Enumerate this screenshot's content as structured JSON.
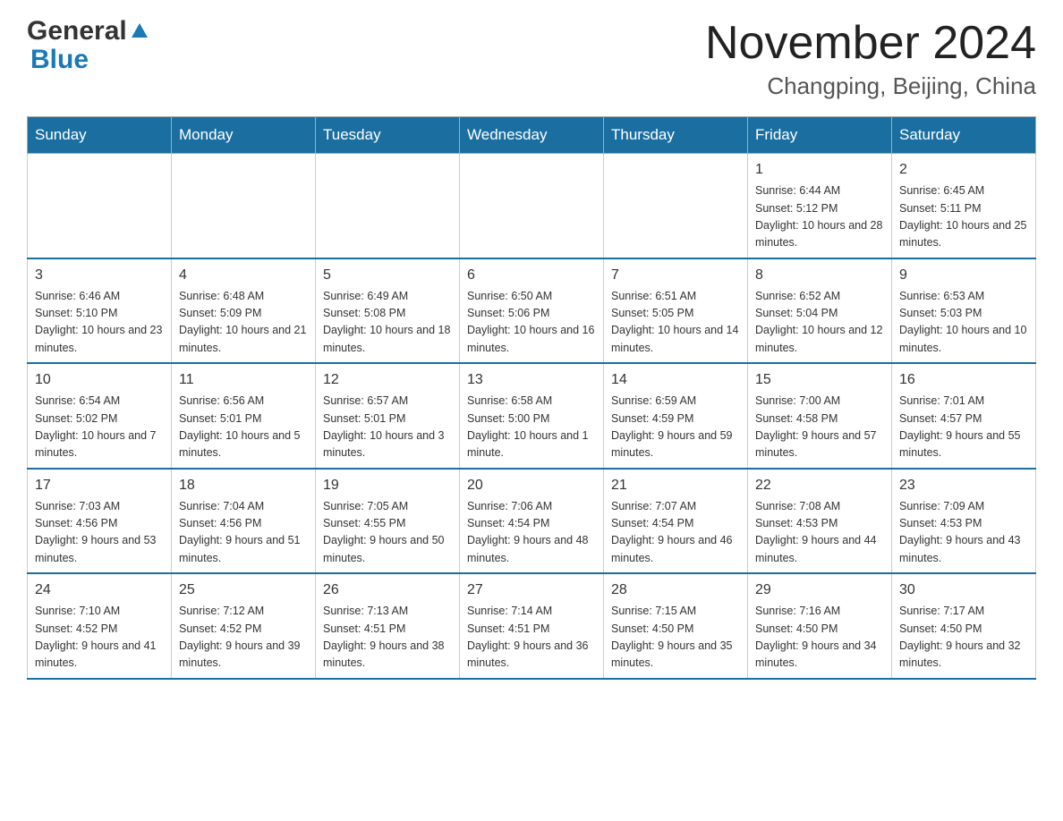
{
  "logo": {
    "general": "General",
    "blue": "Blue"
  },
  "title": "November 2024",
  "subtitle": "Changping, Beijing, China",
  "days_of_week": [
    "Sunday",
    "Monday",
    "Tuesday",
    "Wednesday",
    "Thursday",
    "Friday",
    "Saturday"
  ],
  "weeks": [
    [
      {
        "day": "",
        "info": ""
      },
      {
        "day": "",
        "info": ""
      },
      {
        "day": "",
        "info": ""
      },
      {
        "day": "",
        "info": ""
      },
      {
        "day": "",
        "info": ""
      },
      {
        "day": "1",
        "info": "Sunrise: 6:44 AM\nSunset: 5:12 PM\nDaylight: 10 hours and 28 minutes."
      },
      {
        "day": "2",
        "info": "Sunrise: 6:45 AM\nSunset: 5:11 PM\nDaylight: 10 hours and 25 minutes."
      }
    ],
    [
      {
        "day": "3",
        "info": "Sunrise: 6:46 AM\nSunset: 5:10 PM\nDaylight: 10 hours and 23 minutes."
      },
      {
        "day": "4",
        "info": "Sunrise: 6:48 AM\nSunset: 5:09 PM\nDaylight: 10 hours and 21 minutes."
      },
      {
        "day": "5",
        "info": "Sunrise: 6:49 AM\nSunset: 5:08 PM\nDaylight: 10 hours and 18 minutes."
      },
      {
        "day": "6",
        "info": "Sunrise: 6:50 AM\nSunset: 5:06 PM\nDaylight: 10 hours and 16 minutes."
      },
      {
        "day": "7",
        "info": "Sunrise: 6:51 AM\nSunset: 5:05 PM\nDaylight: 10 hours and 14 minutes."
      },
      {
        "day": "8",
        "info": "Sunrise: 6:52 AM\nSunset: 5:04 PM\nDaylight: 10 hours and 12 minutes."
      },
      {
        "day": "9",
        "info": "Sunrise: 6:53 AM\nSunset: 5:03 PM\nDaylight: 10 hours and 10 minutes."
      }
    ],
    [
      {
        "day": "10",
        "info": "Sunrise: 6:54 AM\nSunset: 5:02 PM\nDaylight: 10 hours and 7 minutes."
      },
      {
        "day": "11",
        "info": "Sunrise: 6:56 AM\nSunset: 5:01 PM\nDaylight: 10 hours and 5 minutes."
      },
      {
        "day": "12",
        "info": "Sunrise: 6:57 AM\nSunset: 5:01 PM\nDaylight: 10 hours and 3 minutes."
      },
      {
        "day": "13",
        "info": "Sunrise: 6:58 AM\nSunset: 5:00 PM\nDaylight: 10 hours and 1 minute."
      },
      {
        "day": "14",
        "info": "Sunrise: 6:59 AM\nSunset: 4:59 PM\nDaylight: 9 hours and 59 minutes."
      },
      {
        "day": "15",
        "info": "Sunrise: 7:00 AM\nSunset: 4:58 PM\nDaylight: 9 hours and 57 minutes."
      },
      {
        "day": "16",
        "info": "Sunrise: 7:01 AM\nSunset: 4:57 PM\nDaylight: 9 hours and 55 minutes."
      }
    ],
    [
      {
        "day": "17",
        "info": "Sunrise: 7:03 AM\nSunset: 4:56 PM\nDaylight: 9 hours and 53 minutes."
      },
      {
        "day": "18",
        "info": "Sunrise: 7:04 AM\nSunset: 4:56 PM\nDaylight: 9 hours and 51 minutes."
      },
      {
        "day": "19",
        "info": "Sunrise: 7:05 AM\nSunset: 4:55 PM\nDaylight: 9 hours and 50 minutes."
      },
      {
        "day": "20",
        "info": "Sunrise: 7:06 AM\nSunset: 4:54 PM\nDaylight: 9 hours and 48 minutes."
      },
      {
        "day": "21",
        "info": "Sunrise: 7:07 AM\nSunset: 4:54 PM\nDaylight: 9 hours and 46 minutes."
      },
      {
        "day": "22",
        "info": "Sunrise: 7:08 AM\nSunset: 4:53 PM\nDaylight: 9 hours and 44 minutes."
      },
      {
        "day": "23",
        "info": "Sunrise: 7:09 AM\nSunset: 4:53 PM\nDaylight: 9 hours and 43 minutes."
      }
    ],
    [
      {
        "day": "24",
        "info": "Sunrise: 7:10 AM\nSunset: 4:52 PM\nDaylight: 9 hours and 41 minutes."
      },
      {
        "day": "25",
        "info": "Sunrise: 7:12 AM\nSunset: 4:52 PM\nDaylight: 9 hours and 39 minutes."
      },
      {
        "day": "26",
        "info": "Sunrise: 7:13 AM\nSunset: 4:51 PM\nDaylight: 9 hours and 38 minutes."
      },
      {
        "day": "27",
        "info": "Sunrise: 7:14 AM\nSunset: 4:51 PM\nDaylight: 9 hours and 36 minutes."
      },
      {
        "day": "28",
        "info": "Sunrise: 7:15 AM\nSunset: 4:50 PM\nDaylight: 9 hours and 35 minutes."
      },
      {
        "day": "29",
        "info": "Sunrise: 7:16 AM\nSunset: 4:50 PM\nDaylight: 9 hours and 34 minutes."
      },
      {
        "day": "30",
        "info": "Sunrise: 7:17 AM\nSunset: 4:50 PM\nDaylight: 9 hours and 32 minutes."
      }
    ]
  ]
}
